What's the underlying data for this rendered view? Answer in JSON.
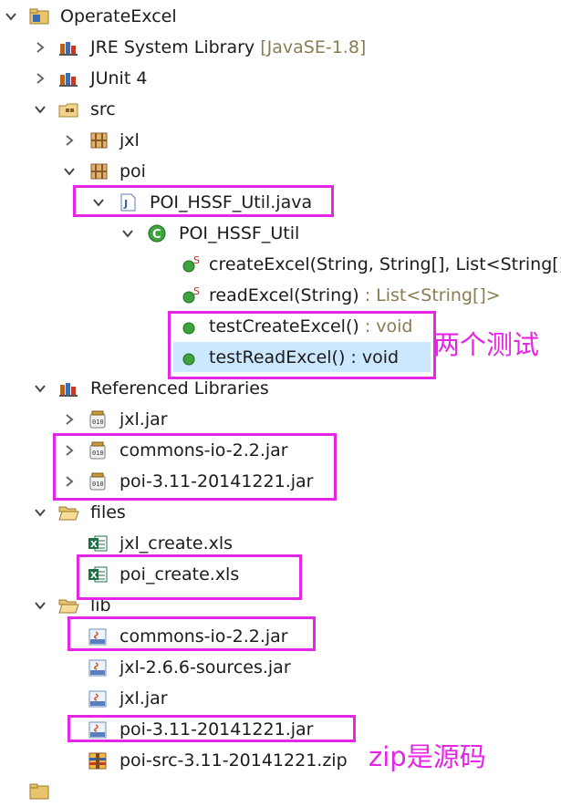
{
  "tree": {
    "project": "OperateExcel",
    "jre": {
      "label": "JRE System Library",
      "decoration": "[JavaSE-1.8]"
    },
    "junit": "JUnit 4",
    "src": "src",
    "pkg_jxl": "jxl",
    "pkg_poi": "poi",
    "java_file": "POI_HSSF_Util.java",
    "class_name": "POI_HSSF_Util",
    "methods": [
      {
        "label": "createExcel(String, String[], List<String[]",
        "type": "",
        "static": true
      },
      {
        "label": "readExcel(String)",
        "type": " : List<String[]>",
        "static": true
      },
      {
        "label": "testCreateExcel()",
        "type": " : void",
        "static": false
      },
      {
        "label": "testReadExcel() : void",
        "type": "",
        "static": false
      }
    ],
    "referenced_libraries": "Referenced Libraries",
    "ref_jars": [
      "jxl.jar",
      "commons-io-2.2.jar",
      "poi-3.11-20141221.jar"
    ],
    "files_folder": "files",
    "files": [
      "jxl_create.xls",
      "poi_create.xls"
    ],
    "lib_folder": "lib",
    "lib_files": [
      "commons-io-2.2.jar",
      "jxl-2.6.6-sources.jar",
      "jxl.jar",
      "poi-3.11-20141221.jar",
      "poi-src-3.11-20141221.zip"
    ]
  },
  "annotations": {
    "two_tests": "两个测试",
    "zip_note": "zip是源码"
  },
  "colors": {
    "highlight_box": "#e526e5",
    "selection": "#cce8ff"
  }
}
